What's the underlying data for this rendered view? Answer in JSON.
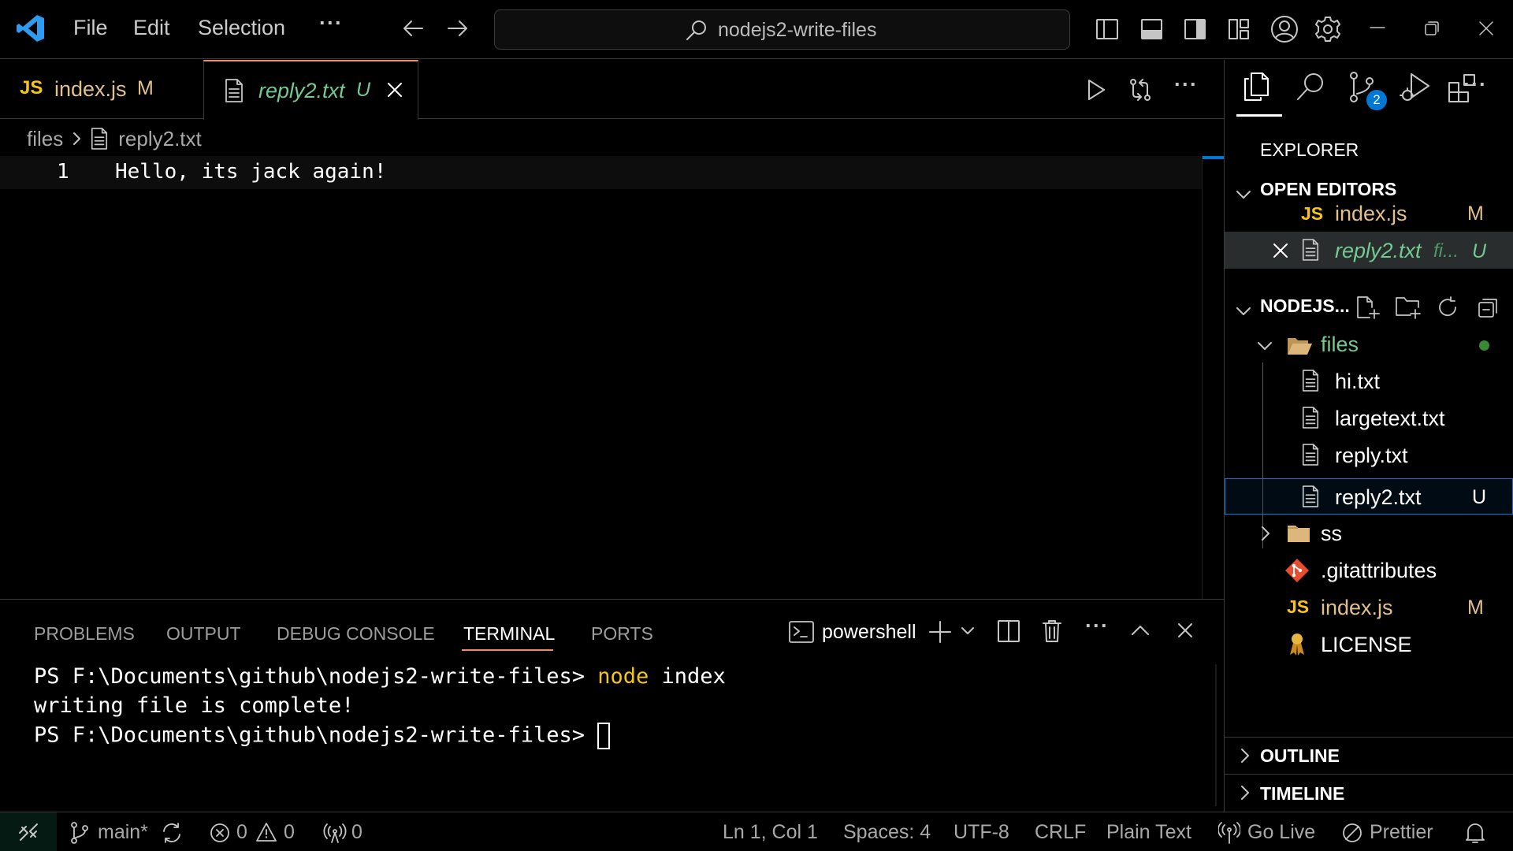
{
  "titlebar": {
    "menu": [
      "File",
      "Edit",
      "Selection"
    ],
    "more_label": "···",
    "search_text": "nodejs2-write-files"
  },
  "tabs": [
    {
      "icon": "JS",
      "label": "index.js",
      "badge": "M"
    },
    {
      "label": "reply2.txt",
      "badge": "U",
      "active": true
    }
  ],
  "editor": {
    "breadcrumb": [
      "files",
      "reply2.txt"
    ],
    "lines": [
      {
        "number": "1",
        "text": "Hello, its jack again!"
      }
    ]
  },
  "panel": {
    "tabs": [
      "PROBLEMS",
      "OUTPUT",
      "DEBUG CONSOLE",
      "TERMINAL",
      "PORTS"
    ],
    "active_tab": "TERMINAL",
    "shell": "powershell",
    "terminal": {
      "line1_prompt": "PS F:\\Documents\\github\\nodejs2-write-files> ",
      "line1_cmd": "node",
      "line1_args": " index",
      "line2": "writing file is complete!",
      "line3_prompt": "PS F:\\Documents\\github\\nodejs2-write-files> "
    }
  },
  "sidebar": {
    "title": "EXPLORER",
    "scm_badge": "2",
    "open_editors": {
      "header": "OPEN EDITORS",
      "items": [
        {
          "icon": "JS",
          "label": "index.js",
          "badge": "M"
        },
        {
          "label": "reply2.txt",
          "desc": "fi...",
          "badge": "U"
        }
      ]
    },
    "project": {
      "header": "NODEJS...",
      "items": [
        {
          "label": "files"
        },
        {
          "label": "hi.txt"
        },
        {
          "label": "largetext.txt"
        },
        {
          "label": "reply.txt"
        },
        {
          "label": "reply2.txt",
          "badge": "U"
        },
        {
          "label": "ss"
        },
        {
          "label": ".gitattributes"
        },
        {
          "icon": "JS",
          "label": "index.js",
          "badge": "M"
        },
        {
          "label": "LICENSE"
        }
      ]
    },
    "outline": "OUTLINE",
    "timeline": "TIMELINE"
  },
  "statusbar": {
    "branch": "main*",
    "errors": "0",
    "warnings": "0",
    "ports": "0",
    "position": "Ln 1, Col 1",
    "spaces": "Spaces: 4",
    "encoding": "UTF-8",
    "eol": "CRLF",
    "language": "Plain Text",
    "golive": "Go Live",
    "prettier": "Prettier"
  },
  "colors": {
    "js_yellow": "#f5c518",
    "modified": "#e2c08d",
    "untracked": "#73c991",
    "accent": "#0078d4",
    "terminal_cmd": "#f5c518"
  }
}
